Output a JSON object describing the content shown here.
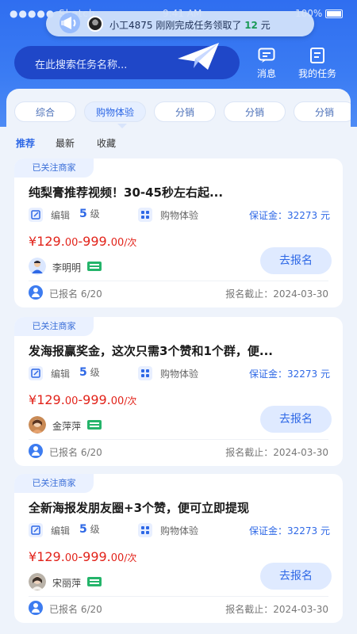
{
  "status_bar": {
    "carrier": "●●●●● Sketch",
    "time": "9:41 AM",
    "battery": "100%"
  },
  "ticker": {
    "prefix": "小工4875 刚刚完成任务领取了",
    "amount": "12",
    "suffix": "元"
  },
  "search": {
    "placeholder": "在此搜索任务名称..."
  },
  "header_actions": [
    {
      "label": "消息",
      "icon": "message-icon"
    },
    {
      "label": "我的任务",
      "icon": "task-list-icon"
    }
  ],
  "categories": [
    {
      "label": "综合",
      "active": false
    },
    {
      "label": "购物体验",
      "active": true
    },
    {
      "label": "分销",
      "active": false
    },
    {
      "label": "分销",
      "active": false
    },
    {
      "label": "分销",
      "active": false
    }
  ],
  "sort_tabs": [
    {
      "label": "推荐",
      "active": true
    },
    {
      "label": "最新",
      "active": false
    },
    {
      "label": "收藏",
      "active": false
    }
  ],
  "cards": [
    {
      "tag": "已关注商家",
      "title": "纯梨膏推荐视频！30-45秒左右起...",
      "edit_label": "编辑",
      "level_num": "5",
      "level_unit": "级",
      "type": "购物体验",
      "deposit": "保证金：32273 元",
      "price_currency": "¥",
      "price_low": "129.",
      "price_low_dec": "00",
      "price_dash": "-",
      "price_high": "999.",
      "price_high_dec": "00",
      "price_unit": "/次",
      "user": "李明明",
      "join": "去报名",
      "signed": "已报名 6/20",
      "deadline": "报名截止：2024-03-30"
    },
    {
      "tag": "已关注商家",
      "title": "发海报赢奖金，这次只需3个赞和1个群，便...",
      "edit_label": "编辑",
      "level_num": "5",
      "level_unit": "级",
      "type": "购物体验",
      "deposit": "保证金：32273 元",
      "price_currency": "¥",
      "price_low": "129.",
      "price_low_dec": "00",
      "price_dash": "-",
      "price_high": "999.",
      "price_high_dec": "00",
      "price_unit": "/次",
      "user": "金萍萍",
      "join": "去报名",
      "signed": "已报名 6/20",
      "deadline": "报名截止：2024-03-30"
    },
    {
      "tag": "已关注商家",
      "title": "全新海报发朋友圈+3个赞，便可立即提现",
      "edit_label": "编辑",
      "level_num": "5",
      "level_unit": "级",
      "type": "购物体验",
      "deposit": "保证金：32273 元",
      "price_currency": "¥",
      "price_low": "129.",
      "price_low_dec": "00",
      "price_dash": "-",
      "price_high": "999.",
      "price_high_dec": "00",
      "price_unit": "/次",
      "user": "宋丽萍",
      "join": "去报名",
      "signed": "已报名 6/20",
      "deadline": "报名截止：2024-03-30"
    }
  ],
  "colors": {
    "brand_blue": "#2e68e6",
    "price_red": "#e2231a",
    "verify_green": "#24b46a"
  }
}
